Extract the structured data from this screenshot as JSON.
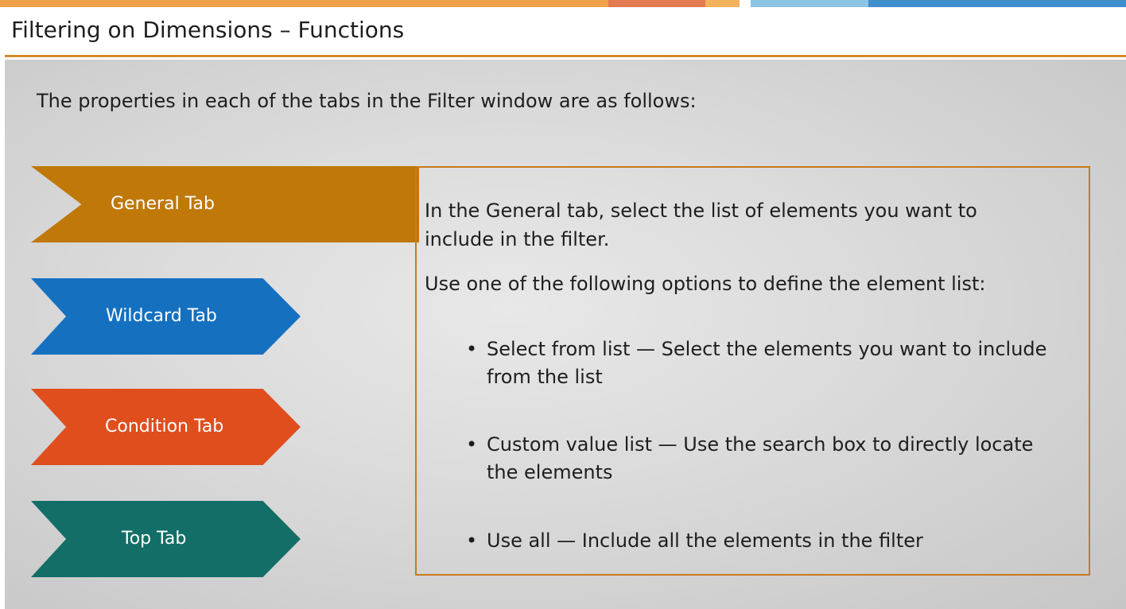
{
  "header": {
    "title": "Filtering on Dimensions – Functions"
  },
  "colors": {
    "accent": "#d88a2a",
    "general": "#c07808",
    "wildcard": "#1570c0",
    "condition": "#e04e1e",
    "top": "#126e66",
    "bar_orange": "#f0a24a",
    "bar_red": "#e47a52",
    "bar_light_blue": "#8cc4e4",
    "bar_blue": "#3f8fcf"
  },
  "main": {
    "intro": "The properties in each of the tabs in the Filter window are as follows:",
    "tabs": [
      {
        "label": "General Tab",
        "selected": true
      },
      {
        "label": "Wildcard Tab",
        "selected": false
      },
      {
        "label": "Condition Tab",
        "selected": false
      },
      {
        "label": "Top Tab",
        "selected": false
      }
    ],
    "detail": {
      "para1_line1": "In the General tab, select the list of elements you want to",
      "para1_line2": "include in the filter.",
      "para2": "Use one of the following options to define the element list:",
      "bullet_symbol": "•",
      "bullets": [
        {
          "line1": "Select from list — Select the elements you want to include",
          "line2": "from the list"
        },
        {
          "line1": "Custom value list — Use the search box to directly locate",
          "line2": "the elements"
        },
        {
          "line1": "Use all — Include all the elements in the filter",
          "line2": ""
        }
      ]
    }
  }
}
